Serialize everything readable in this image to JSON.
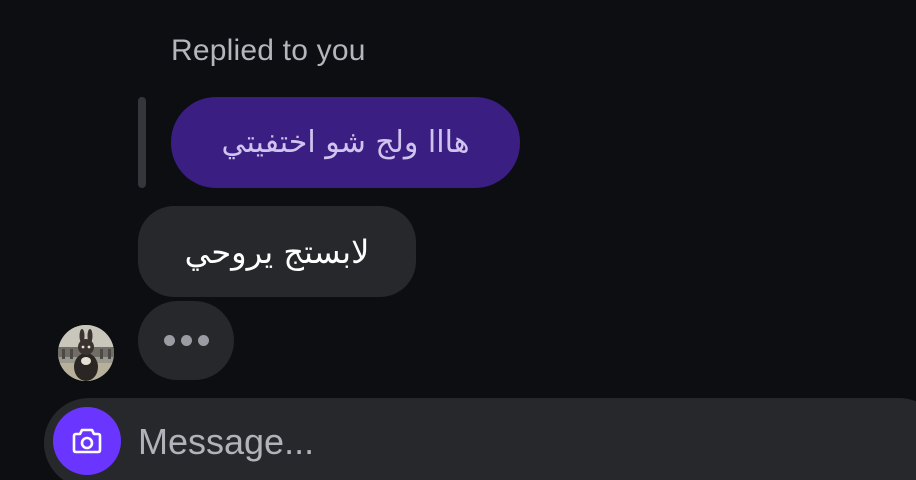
{
  "thread": {
    "reply_caption": "Replied to you",
    "replied_message": "هااا ولج شو اختفيتي",
    "received_message": "لابستج يروحي",
    "typing_indicator": "•••"
  },
  "composer": {
    "placeholder": "Message...",
    "camera_icon": "camera-icon"
  },
  "colors": {
    "background": "#0c0e12",
    "replied_bubble": "#3b1e82",
    "received_bubble": "#26282c",
    "camera_button": "#6a35ff"
  }
}
